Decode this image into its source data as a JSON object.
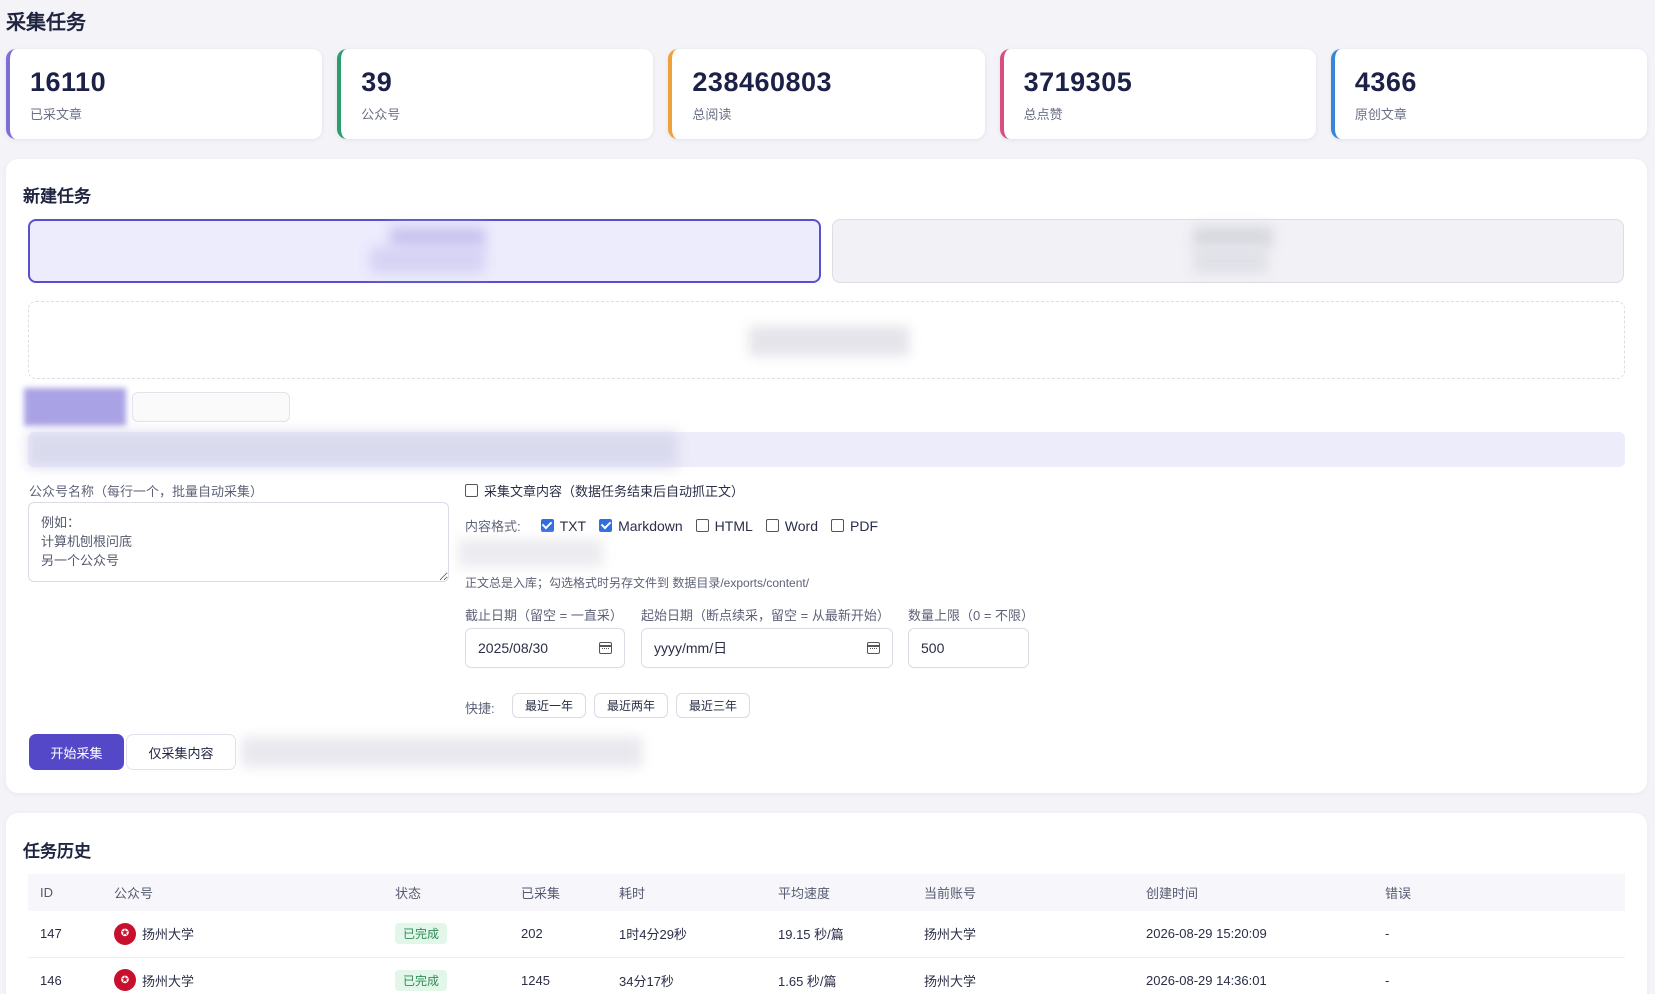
{
  "page": {
    "title": "采集任务"
  },
  "stats": [
    {
      "value": "16110",
      "label": "已采文章",
      "color": "#7b6fd6"
    },
    {
      "value": "39",
      "label": "公众号",
      "color": "#2a9d6b"
    },
    {
      "value": "238460803",
      "label": "总阅读",
      "color": "#f0a23a"
    },
    {
      "value": "3719305",
      "label": "总点赞",
      "color": "#d64f7e"
    },
    {
      "value": "4366",
      "label": "原创文章",
      "color": "#3a86d6"
    }
  ],
  "new_task": {
    "title": "新建任务",
    "account_label": "公众号名称（每行一个，批量自动采集）",
    "account_placeholder": "例如：\n计算机刨根问底\n另一个公众号",
    "collect_content_label": "采集文章内容（数据任务结束后自动抓正文）",
    "format_label": "内容格式:",
    "formats": [
      {
        "label": "TXT",
        "checked": true
      },
      {
        "label": "Markdown",
        "checked": true
      },
      {
        "label": "HTML",
        "checked": false
      },
      {
        "label": "Word",
        "checked": false
      },
      {
        "label": "PDF",
        "checked": false
      }
    ],
    "storage_note": "正文总是入库；勾选格式时另存文件到 数据目录/exports/content/",
    "end_date_label": "截止日期（留空 = 一直采）",
    "end_date_value": "2025/08/30",
    "start_date_label": "起始日期（断点续采，留空 = 从最新开始）",
    "start_date_placeholder": "yyyy/mm/日",
    "limit_label": "数量上限（0 = 不限）",
    "limit_value": "500",
    "quick_label": "快捷:",
    "quick_buttons": [
      "最近一年",
      "最近两年",
      "最近三年"
    ],
    "start_button": "开始采集",
    "content_only_button": "仅采集内容"
  },
  "history": {
    "title": "任务历史",
    "columns": [
      "ID",
      "公众号",
      "状态",
      "已采集",
      "耗时",
      "平均速度",
      "当前账号",
      "创建时间",
      "错误"
    ],
    "rows": [
      {
        "id": "147",
        "account": "扬州大学",
        "status": "已完成",
        "collected": "202",
        "duration": "1时4分29秒",
        "speed": "19.15 秒/篇",
        "current_account": "扬州大学",
        "created": "2026-08-29 15:20:09",
        "error": "-"
      },
      {
        "id": "146",
        "account": "扬州大学",
        "status": "已完成",
        "collected": "1245",
        "duration": "34分17秒",
        "speed": "1.65 秒/篇",
        "current_account": "扬州大学",
        "created": "2026-08-29 14:36:01",
        "error": "-"
      }
    ]
  }
}
